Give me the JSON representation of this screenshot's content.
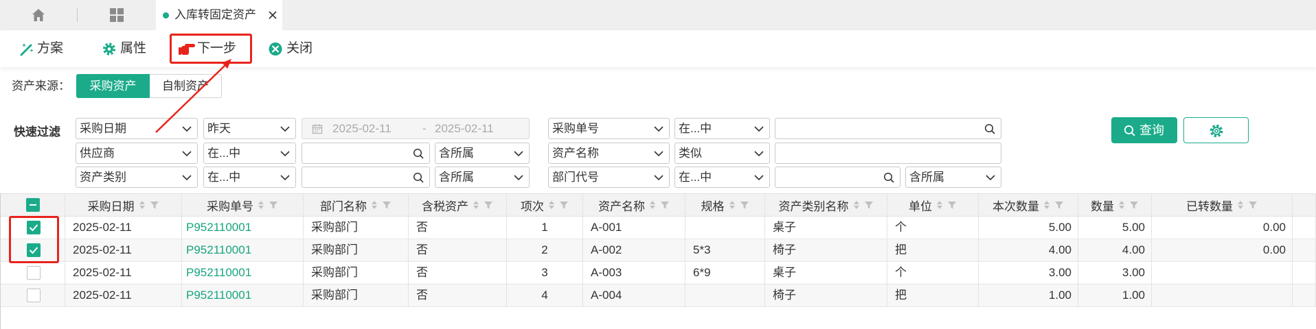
{
  "colors": {
    "accent": "#1bab8a",
    "link": "#17a57e",
    "annotation": "#e8231b"
  },
  "tabbar": {
    "home_icon": "home-icon",
    "apps_icon": "grid-icon",
    "active_tab": {
      "label": "入库转固定资产",
      "status_icon": "dot-icon",
      "close_icon": "close-icon"
    }
  },
  "toolbar": {
    "items": [
      {
        "label": "方案",
        "icon": "wand-icon"
      },
      {
        "label": "属性",
        "icon": "gear-icon"
      },
      {
        "label": "下一步",
        "icon": "pointing-hand-icon"
      },
      {
        "label": "关闭",
        "icon": "close-circle-icon"
      }
    ]
  },
  "source": {
    "label": "资产来源：",
    "options": [
      {
        "label": "采购资产",
        "selected": true
      },
      {
        "label": "自制资产",
        "selected": false
      }
    ]
  },
  "quick_filter": {
    "label": "快速过滤",
    "rows": [
      {
        "field": "采购日期",
        "operator": "昨天",
        "date_from": "2025-02-11",
        "date_separator": "-",
        "date_to": "2025-02-11",
        "field2": "采购单号",
        "operator2": "在...中",
        "value2": ""
      },
      {
        "field": "供应商",
        "operator": "在...中",
        "value": "",
        "scope": "含所属",
        "field2": "资产名称",
        "operator2": "类似",
        "value2": ""
      },
      {
        "field": "资产类别",
        "operator": "在...中",
        "value": "",
        "scope": "含所属",
        "field2": "部门代号",
        "operator2": "在...中",
        "value2": "",
        "scope2": "含所属"
      }
    ],
    "query_label": "查询",
    "query_icon": "search-icon",
    "settings_icon": "gear-icon"
  },
  "table": {
    "select_all_indeterminate": true,
    "sort_icon": "sort-icon",
    "filter_icon": "filter-icon",
    "columns": [
      "采购日期",
      "采购单号",
      "部门名称",
      "含税资产",
      "项次",
      "资产名称",
      "规格",
      "资产类别名称",
      "单位",
      "本次数量",
      "数量",
      "已转数量"
    ],
    "rows": [
      {
        "checked": true,
        "cells": [
          "2025-02-11",
          "P952110001",
          "采购部门",
          "否",
          "1",
          "A-001",
          "",
          "桌子",
          "个",
          "5.00",
          "5.00",
          "0.00"
        ]
      },
      {
        "checked": true,
        "cells": [
          "2025-02-11",
          "P952110001",
          "采购部门",
          "否",
          "2",
          "A-002",
          "5*3",
          "椅子",
          "把",
          "4.00",
          "4.00",
          "0.00"
        ]
      },
      {
        "checked": false,
        "cells": [
          "2025-02-11",
          "P952110001",
          "采购部门",
          "否",
          "3",
          "A-003",
          "6*9",
          "桌子",
          "个",
          "3.00",
          "3.00",
          ""
        ]
      },
      {
        "checked": false,
        "cells": [
          "2025-02-11",
          "P952110001",
          "采购部门",
          "否",
          "4",
          "A-004",
          "",
          "椅子",
          "把",
          "1.00",
          "1.00",
          ""
        ]
      }
    ]
  }
}
